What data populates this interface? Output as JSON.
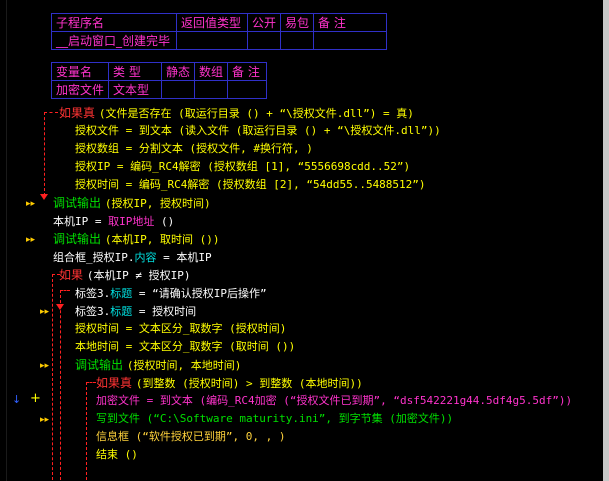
{
  "sub_table": {
    "headers": [
      "子程序名",
      "返回值类型",
      "公开",
      "易包",
      "备 注"
    ],
    "name": "__启动窗口_创建完毕"
  },
  "var_table": {
    "headers": [
      "变量名",
      "类 型",
      "静态",
      "数组",
      "备 注"
    ],
    "row": [
      "加密文件",
      "文本型"
    ]
  },
  "code": {
    "l1": {
      "kw": "如果真",
      "a": "(文件是否存在 (取运行目录 () + “\\授权文件.dll”) = 真)"
    },
    "l2": {
      "a": "授权文件 = 到文本 (读入文件 (取运行目录 () + “\\授权文件.dll”))"
    },
    "l3": {
      "a": "授权数组 = 分割文本 (授权文件, #换行符, )"
    },
    "l4": {
      "a": "授权IP = 编码_RC4解密 (授权数组 [1], “5556698cdd..52”)"
    },
    "l5": {
      "a": "授权时间 = 编码_RC4解密 (授权数组 [2], “54dd55..5488512”)"
    },
    "l6": {
      "kw": "调试输出",
      "a": "(授权IP, 授权时间)"
    },
    "l7": {
      "a": "本机IP = ",
      "b": "取IP地址",
      "c": " ()"
    },
    "l8": {
      "kw": "调试输出",
      "a": "(本机IP, 取时间 ())"
    },
    "l9": {
      "a": "组合框_授权IP.",
      "b": "内容",
      "c": " = 本机IP"
    },
    "l10": {
      "kw": "如果",
      "a": "(本机IP ≠ 授权IP)"
    },
    "l11": {
      "a": "标签3.",
      "b": "标题",
      "c": " = “请确认授权IP后操作”"
    },
    "l12": {
      "a": "标签3.",
      "b": "标题",
      "c": " = 授权时间"
    },
    "l13": {
      "a": "授权时间 = 文本区分_取数字 (授权时间)"
    },
    "l14": {
      "a": "本地时间 = 文本区分_取数字 (取时间 ())"
    },
    "l15": {
      "kw": "调试输出",
      "a": "(授权时间, 本地时间)"
    },
    "l16": {
      "kw": "如果真",
      "a": "(到整数 (授权时间) > 到整数 (本地时间))"
    },
    "l17": {
      "a": "加密文件 = 到文本 (编码_RC4加密 (“授权文件已到期”, “dsf542221g44.5df4g5.5df”))"
    },
    "l18": {
      "a": "写到文件 (“C:\\Software maturity.ini”, 到字节集 (加密文件))"
    },
    "l19": {
      "a": "信息框 (“软件授权已到期”, 0, , )"
    },
    "l20": {
      "a": "结束 ()"
    }
  }
}
